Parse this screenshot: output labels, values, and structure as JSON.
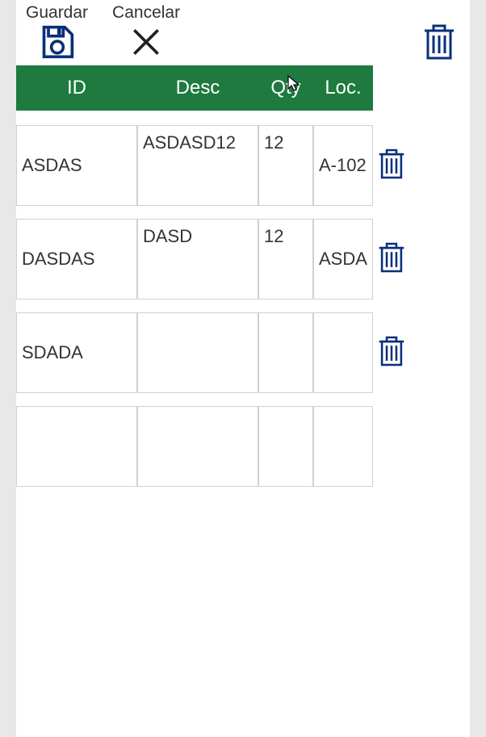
{
  "colors": {
    "header_bg": "#1e7a3e",
    "icon_blue": "#0a2f7a",
    "border": "#d0d0d0"
  },
  "toolbar": {
    "save_label": "Guardar",
    "cancel_label": "Cancelar"
  },
  "table": {
    "headers": {
      "id": "ID",
      "desc": "Desc",
      "qty": "Qty",
      "loc": "Loc."
    },
    "rows": [
      {
        "id": "ASDAS",
        "desc": "ASDASD12",
        "qty": "12",
        "loc": "A-102",
        "has_delete": true
      },
      {
        "id": "DASDAS",
        "desc": "DASD",
        "qty": "12",
        "loc": "ASDA",
        "has_delete": true
      },
      {
        "id": "SDADA",
        "desc": "",
        "qty": "",
        "loc": "",
        "has_delete": true
      },
      {
        "id": "",
        "desc": "",
        "qty": "",
        "loc": "",
        "has_delete": false
      }
    ]
  }
}
